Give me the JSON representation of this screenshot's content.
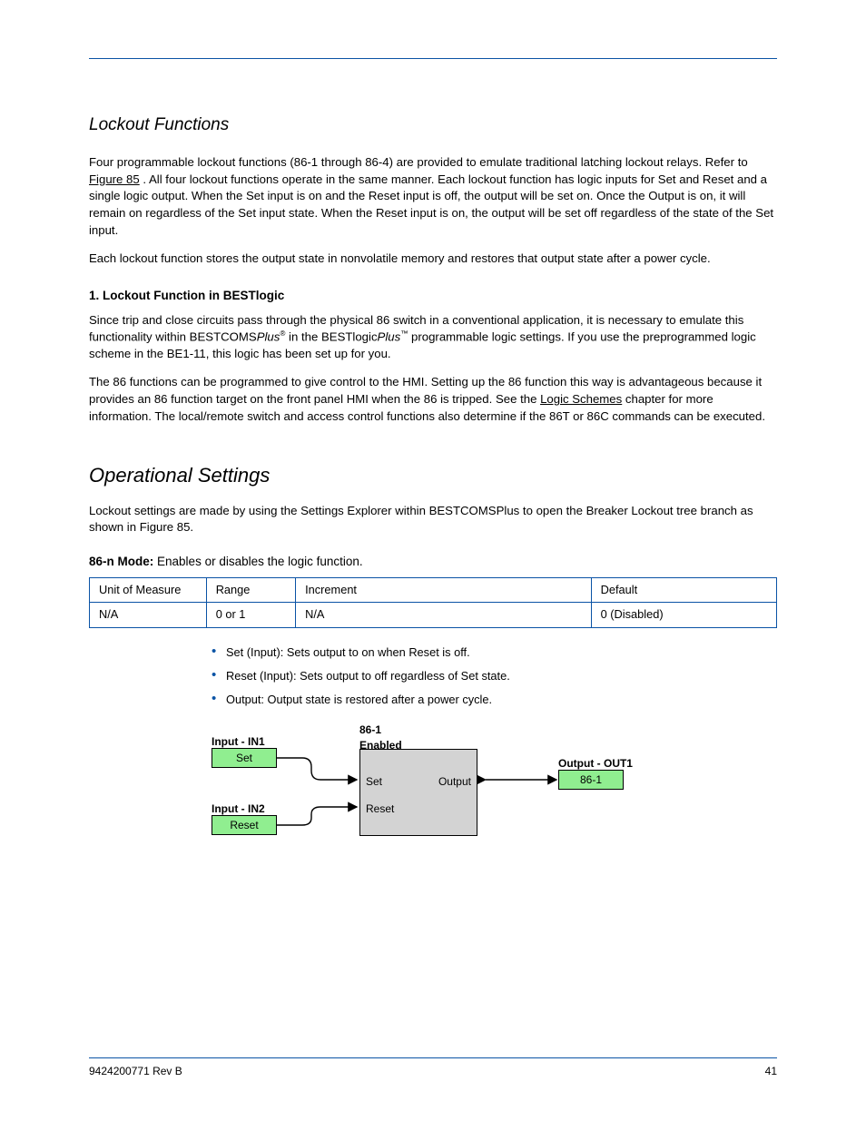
{
  "section": {
    "title": "Lockout Functions",
    "intro": "Four programmable lockout functions (86-1 through 86-4) are provided to emulate traditional latching lockout relays. Refer to",
    "intro_emph_ref": "Figure 85",
    "intro_cont": ". All four lockout functions operate in the same manner. Each lockout function has logic inputs for Set and Reset and a single logic output. When the Set input is on and the Reset input is off, the output will be set on. Once the Output is on, it will remain on regardless of the Set input state. When the Reset input is on, the output will be set off regardless of the state of the Set input.",
    "p2": "Each lockout function stores the output state in nonvolatile memory and restores that output state after a power cycle.",
    "sub1_title": "1. Lockout Function in BESTlogic",
    "sub1_p1a": "Since trip and close circuits pass through the physical 86 switch in a conventional application, it is necessary to emulate this functionality within BESTCOMS",
    "sub1_p1b": " in the BESTlogic",
    "sub1_p1c": " programmable logic settings. If you use the preprogrammed logic scheme in the BE1-11, this logic has been set up for you.",
    "sub1_p2a": "The 86 functions can be programmed to give control to the HMI. Setting up the 86 function this way is advantageous because it provides an 86 function target on the front panel HMI when the 86 is tripped.",
    "sub1_p2b": ". The local/remote switch and access control functions also determine if the 86T or 86C commands can be executed.",
    "sub1_p2_linkA": "See the ",
    "sub1_p2_linkB": "Logic Schemes",
    "sub1_p2_linkC": " chapter for more information",
    "h2": "Operational Settings",
    "h2_p": "Lockout settings are made by using the Settings Explorer within BESTCOMSPlus to open the Breaker Lockout tree branch as shown in Figure 85.",
    "param_label": "86-n Mode:",
    "param_desc": "Enables or disables the logic function.",
    "table": {
      "h": [
        "Unit of Measure",
        "Range",
        "Increment",
        "Default"
      ],
      "r": [
        "N/A",
        "0 or 1",
        "N/A",
        "0 (Disabled)"
      ]
    },
    "io_items": [
      "Set (Input): Sets output to on when Reset is off.",
      "Reset (Input): Sets output to off regardless of Set state.",
      "Output: Output state is restored after a power cycle."
    ],
    "diagram": {
      "blk": "86-1\nEnabled",
      "in1_lbl": "Input - IN1",
      "in1_txt": "Set",
      "in2_lbl": "Input - IN2",
      "in2_txt": "Reset",
      "set": "Set",
      "reset": "Reset",
      "output": "Output",
      "out_lbl": "Output - OUT1",
      "out_txt": "86-1"
    }
  },
  "footer": {
    "left": "9424200771 Rev B",
    "right": "41"
  }
}
